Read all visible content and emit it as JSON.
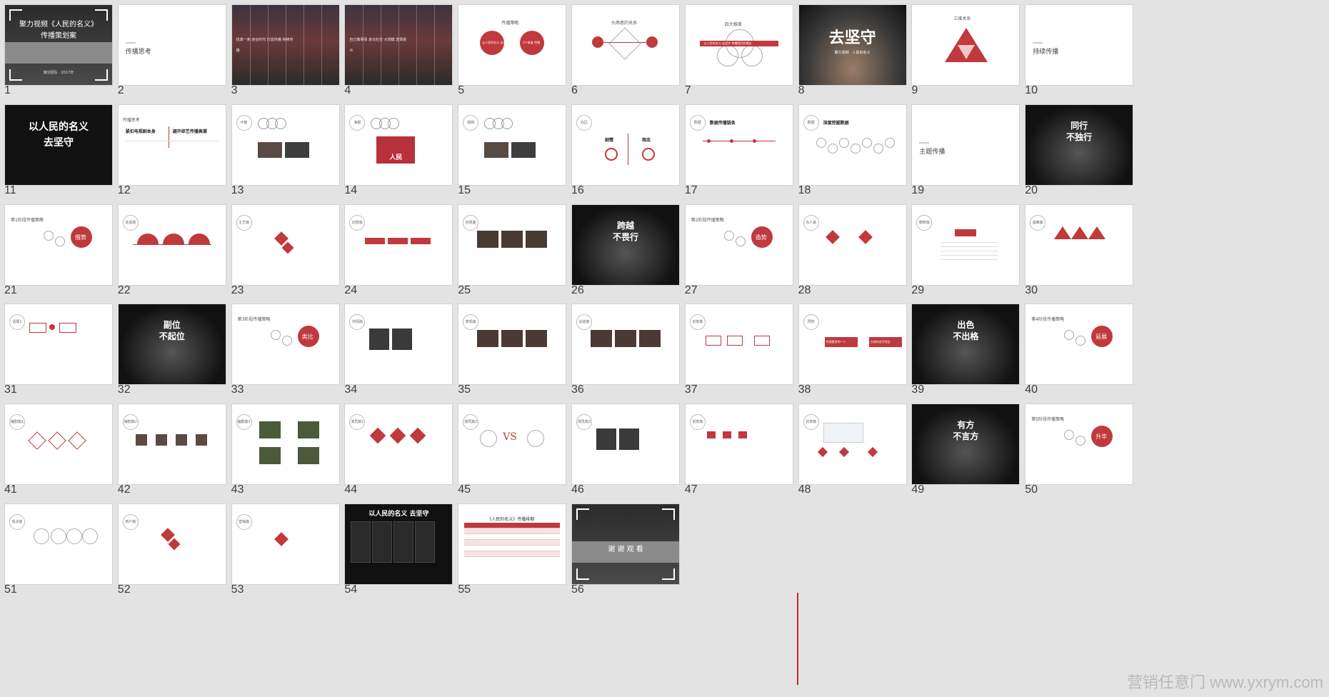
{
  "colors": {
    "accent": "#c0393d",
    "background": "#e3e3e3",
    "dark": "#111111"
  },
  "slides": [
    {
      "n": "1",
      "kind": "cover",
      "title1": "聚力视频《人民的名义》",
      "title2": "传播策划案",
      "sub": "策划团队 · 2017年"
    },
    {
      "n": "2",
      "kind": "section",
      "label": "传播思考"
    },
    {
      "n": "3",
      "kind": "photo",
      "text": "找准一条 迎合时代 打造传播 持续传播"
    },
    {
      "n": "4",
      "kind": "photo",
      "text": "自己做事情 走出社交 大规模 选择受众"
    },
    {
      "n": "5",
      "kind": "circles2",
      "title": "传播策略",
      "a": "以人民的名义 去坚守",
      "b": "2个维度 传播"
    },
    {
      "n": "6",
      "kind": "venn",
      "title": "头两者的关系"
    },
    {
      "n": "7",
      "kind": "band",
      "title": "四大维度",
      "band": "以人民的名义 去坚守 传播我们的理念"
    },
    {
      "n": "8",
      "kind": "dark-photo",
      "big": "去坚守",
      "small": "聚力视频 · 人民的名义"
    },
    {
      "n": "9",
      "kind": "triangle",
      "title": "三维关系"
    },
    {
      "n": "10",
      "kind": "section",
      "label": "持续传播"
    },
    {
      "n": "11",
      "kind": "dark",
      "big": "以人民的名义",
      "big2": "去坚守"
    },
    {
      "n": "12",
      "kind": "twohead",
      "h1": "紧扣电视剧本身",
      "h2": "避开综艺传播高潮",
      "title": "传播思考"
    },
    {
      "n": "13",
      "kind": "rings",
      "tag": "IP篇"
    },
    {
      "n": "14",
      "kind": "redbox",
      "tag": "海报",
      "box": "人民"
    },
    {
      "n": "15",
      "kind": "rings",
      "tag": "视频"
    },
    {
      "n": "16",
      "kind": "twocol",
      "tag": "社区",
      "a": "剧情",
      "b": "观念"
    },
    {
      "n": "17",
      "kind": "timeline",
      "tag": "数据",
      "title": "数据传播链条"
    },
    {
      "n": "18",
      "kind": "bubbles",
      "tag": "数据",
      "title": "深度挖掘数据"
    },
    {
      "n": "19",
      "kind": "section",
      "label": "主题传播"
    },
    {
      "n": "20",
      "kind": "dark",
      "big": "同行",
      "big2": "不独行"
    },
    {
      "n": "21",
      "kind": "phase",
      "title": "第1阶段传播策略",
      "circle": "借势"
    },
    {
      "n": "22",
      "kind": "arches",
      "tag": "造话题"
    },
    {
      "n": "23",
      "kind": "hexes",
      "tag": "主艺篇"
    },
    {
      "n": "24",
      "kind": "buttons",
      "tag": "创意篇"
    },
    {
      "n": "25",
      "kind": "photos3",
      "tag": "创意篇"
    },
    {
      "n": "26",
      "kind": "dark",
      "big": "跨越",
      "big2": "不畏行"
    },
    {
      "n": "27",
      "kind": "phase",
      "title": "第2阶段传播策略",
      "circle": "造势"
    },
    {
      "n": "28",
      "kind": "diamonds",
      "tag": "鸟人篇"
    },
    {
      "n": "29",
      "kind": "list",
      "tag": "朝鲜篇"
    },
    {
      "n": "30",
      "kind": "tri3",
      "tag": "温暖篇"
    },
    {
      "n": "31",
      "kind": "flow",
      "tag": "话题1"
    },
    {
      "n": "32",
      "kind": "dark",
      "big": "副位",
      "big2": "不起位"
    },
    {
      "n": "33",
      "kind": "phase",
      "title": "第3阶段传播策略",
      "circle": "类比"
    },
    {
      "n": "34",
      "kind": "photos2",
      "tag": "共情篇"
    },
    {
      "n": "35",
      "kind": "photos3",
      "tag": "表现篇"
    },
    {
      "n": "36",
      "kind": "photos3",
      "tag": "总结篇"
    },
    {
      "n": "37",
      "kind": "boxes",
      "tag": "创意篇"
    },
    {
      "n": "38",
      "kind": "ribbons",
      "tag": "预热",
      "a": "传递更多的一人",
      "b": "立体的去不完全"
    },
    {
      "n": "39",
      "kind": "dark",
      "big": "出色",
      "big2": "不出格"
    },
    {
      "n": "40",
      "kind": "phase",
      "title": "第4阶段传播策略",
      "circle": "延展"
    },
    {
      "n": "41",
      "kind": "diam3",
      "tag": "编剧篇1"
    },
    {
      "n": "42",
      "kind": "faces",
      "tag": "编剧篇2"
    },
    {
      "n": "43",
      "kind": "quad",
      "tag": "编剧篇3"
    },
    {
      "n": "44",
      "kind": "diam3r",
      "tag": "演员篇1"
    },
    {
      "n": "45",
      "kind": "vs",
      "tag": "演员篇2",
      "vs": "VS"
    },
    {
      "n": "46",
      "kind": "photos2",
      "tag": "演员篇3"
    },
    {
      "n": "47",
      "kind": "smallred",
      "tag": "创意篇"
    },
    {
      "n": "48",
      "kind": "web",
      "tag": "创意篇"
    },
    {
      "n": "49",
      "kind": "dark",
      "big": "有方",
      "big2": "不言方"
    },
    {
      "n": "50",
      "kind": "phase",
      "title": "第5阶段传播策略",
      "circle": "升华"
    },
    {
      "n": "51",
      "kind": "chain",
      "tag": "观点篇"
    },
    {
      "n": "52",
      "kind": "hex2",
      "tag": "用户篇"
    },
    {
      "n": "53",
      "kind": "hex1",
      "tag": "营销篇"
    },
    {
      "n": "54",
      "kind": "posters",
      "big": "以人民的名义 去坚守"
    },
    {
      "n": "55",
      "kind": "table",
      "title": "《人民的名义》传播排期"
    },
    {
      "n": "56",
      "kind": "cover",
      "title1": "谢 谢 观 看",
      "title2": "",
      "sub": ""
    }
  ],
  "watermark": "营销任意门 www.yxrym.com"
}
